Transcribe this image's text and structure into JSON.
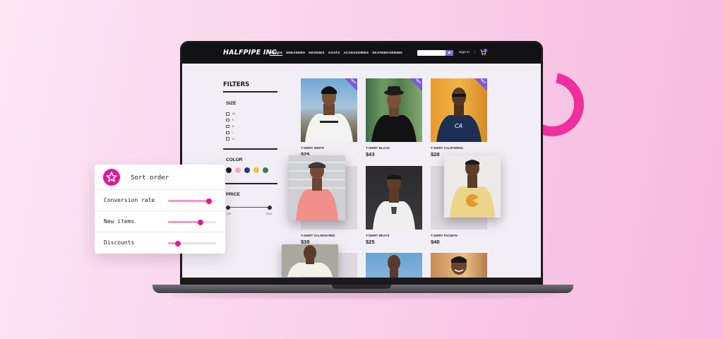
{
  "colors": {
    "accent": "#e2189a",
    "accent_light": "#f19acb",
    "nav_bg": "#121214",
    "new_badge": "#7c5ad6",
    "screen_bg": "#f1eff5"
  },
  "site": {
    "logo": "HALFPIPE INC.",
    "nav_links": [
      "SHIRTS",
      "SNEAKERS",
      "HOODIES",
      "COATS",
      "ACCESSORIES",
      "SKATEBOARDING"
    ],
    "active_link": "SHIRTS",
    "sign_in": "Sign In",
    "separator": "|",
    "cart_icon": "shopping-cart-icon",
    "search_icon": "search-icon"
  },
  "filters": {
    "title": "FILTERS",
    "size_label": "SIZE",
    "sizes": [
      "XS",
      "S",
      "M",
      "L",
      "XL"
    ],
    "color_label": "COLOR",
    "colors": [
      "#1d1d1f",
      "#f4a9c9",
      "#243a73",
      "#f2c12e",
      "#3c7a55"
    ],
    "price_label": "PRICE",
    "price_min": "$15",
    "price_max": "$100"
  },
  "products": [
    {
      "name": "T-SHIRT WHITE",
      "price": "$25",
      "badge": "NEW!"
    },
    {
      "name": "T-SHIRT BLACK",
      "price": "$43",
      "badge": "NEW!"
    },
    {
      "name": "T-SHIRT CALIFORNIA",
      "price": "$28",
      "badge": "NEW!"
    },
    {
      "name": "T-SHIRT SALMON RED",
      "price": "$35",
      "badge": ""
    },
    {
      "name": "T-SHIRT BEATS",
      "price": "$25",
      "badge": ""
    },
    {
      "name": "T-SHIRT PACMAN",
      "price": "$48",
      "badge": ""
    }
  ],
  "sort_panel": {
    "title": "Sort order",
    "icon": "star-icon",
    "rows": [
      {
        "label": "Conversion rate",
        "value": 0.85
      },
      {
        "label": "New items",
        "value": 0.68
      },
      {
        "label": "Discounts",
        "value": 0.2
      }
    ]
  }
}
